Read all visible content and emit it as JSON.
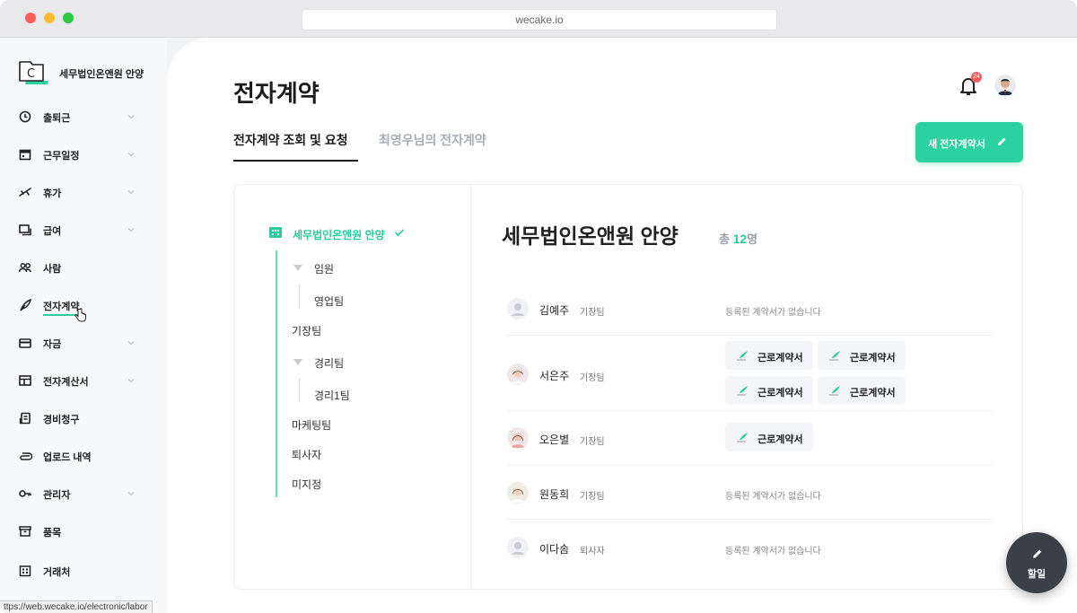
{
  "browser": {
    "url": "wecake.io"
  },
  "status_bar": {
    "link": "ttps://web.wecake.io/electronic/labor"
  },
  "sidebar": {
    "brand": {
      "name": "세무법인온앤원 안양"
    },
    "items": [
      {
        "label": "출퇴근",
        "icon": "clock-icon",
        "has_chevron": true
      },
      {
        "label": "근무일정",
        "icon": "calendar-icon",
        "has_chevron": true
      },
      {
        "label": "휴가",
        "icon": "plane-icon",
        "has_chevron": true
      },
      {
        "label": "급여",
        "icon": "payroll-icon",
        "has_chevron": true
      },
      {
        "label": "사람",
        "icon": "people-icon",
        "has_chevron": false
      },
      {
        "label": "전자계약",
        "icon": "feather-icon",
        "has_chevron": false,
        "active": true
      },
      {
        "label": "자금",
        "icon": "card-icon",
        "has_chevron": true
      },
      {
        "label": "전자계산서",
        "icon": "layout-icon",
        "has_chevron": true
      },
      {
        "label": "경비청구",
        "icon": "receipt-icon",
        "has_chevron": false
      },
      {
        "label": "업로드 내역",
        "icon": "paperclip-icon",
        "has_chevron": false
      },
      {
        "label": "관리자",
        "icon": "key-icon",
        "has_chevron": true
      },
      {
        "label": "품목",
        "icon": "archive-icon",
        "has_chevron": false
      },
      {
        "label": "거래처",
        "icon": "building-icon",
        "has_chevron": false
      }
    ]
  },
  "header": {
    "title": "전자계약",
    "notification_count": "24",
    "tabs": [
      {
        "label": "전자계약 조회 및 요청",
        "active": true
      },
      {
        "label": "최영우님의 전자계약",
        "active": false
      }
    ],
    "new_button_label": "새 전자계약서"
  },
  "org_tree": {
    "root": "세무법인온앤원 안양",
    "nodes": {
      "executives": "임원",
      "sales": "영업팀",
      "bookkeeping": "기장팀",
      "accounting": "경리팀",
      "accounting1": "경리1팀",
      "marketing": "마케팅팀",
      "retired": "퇴사자",
      "unassigned": "미지정"
    }
  },
  "company": {
    "name": "세무법인온앤원 안양",
    "count_prefix": "총",
    "count": "12",
    "count_suffix": "명"
  },
  "employees": [
    {
      "name": "김예주",
      "team": "기장팀",
      "empty_text": "등록된 계약서가 없습니다",
      "contracts": []
    },
    {
      "name": "서은주",
      "team": "기장팀",
      "contracts": [
        "근로계약서",
        "근로계약서",
        "근로계약서",
        "근로계약서"
      ]
    },
    {
      "name": "오은별",
      "team": "기장팀",
      "contracts": [
        "근로계약서"
      ]
    },
    {
      "name": "원동희",
      "team": "기장팀",
      "empty_text": "등록된 계약서가 없습니다",
      "contracts": []
    },
    {
      "name": "이다솜",
      "team": "퇴사자",
      "empty_text": "등록된 계약서가 없습니다",
      "contracts": []
    }
  ],
  "fab": {
    "label": "할일"
  },
  "colors": {
    "accent": "#2bd2a0",
    "accent_text": "#2bcb9c",
    "badge": "#ff5b5b",
    "fab": "#3b4046"
  }
}
